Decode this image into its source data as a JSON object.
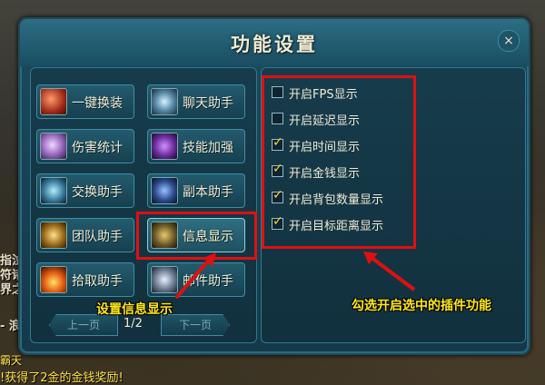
{
  "window": {
    "title": "功能设置",
    "close_label": "×"
  },
  "features": [
    {
      "label": "一键换装",
      "icon": "armor-swap-icon"
    },
    {
      "label": "聊天助手",
      "icon": "chat-icon"
    },
    {
      "label": "伤害统计",
      "icon": "damage-stats-icon"
    },
    {
      "label": "技能加强",
      "icon": "skill-boost-icon"
    },
    {
      "label": "交换助手",
      "icon": "trade-icon"
    },
    {
      "label": "副本助手",
      "icon": "dungeon-icon"
    },
    {
      "label": "团队助手",
      "icon": "team-icon"
    },
    {
      "label": "信息显示",
      "icon": "info-display-icon"
    },
    {
      "label": "拾取助手",
      "icon": "loot-icon"
    },
    {
      "label": "邮件助手",
      "icon": "mail-icon"
    }
  ],
  "pagination": {
    "prev_label": "上一页",
    "next_label": "下一页",
    "page": "1/2"
  },
  "options": [
    {
      "label": "开启FPS显示",
      "checked": false
    },
    {
      "label": "开启延迟显示",
      "checked": false
    },
    {
      "label": "开启时间显示",
      "checked": true
    },
    {
      "label": "开启金钱显示",
      "checked": true
    },
    {
      "label": "开启背包数量显示",
      "checked": true
    },
    {
      "label": "开启目标距离显示",
      "checked": true
    }
  ],
  "annotations": {
    "left": "设置信息显示",
    "right": "勾选开启选中的插件功能"
  },
  "background_text": {
    "side1": "指泣",
    "side2": "符诸",
    "side3": "界之",
    "side4": "- 浪",
    "chat1": "霸天",
    "chat2": "!获得了2金的金钱奖励!"
  },
  "colors": {
    "highlight": "#e01010",
    "annotation": "#ffe81a",
    "accent": "#2f7a90"
  }
}
